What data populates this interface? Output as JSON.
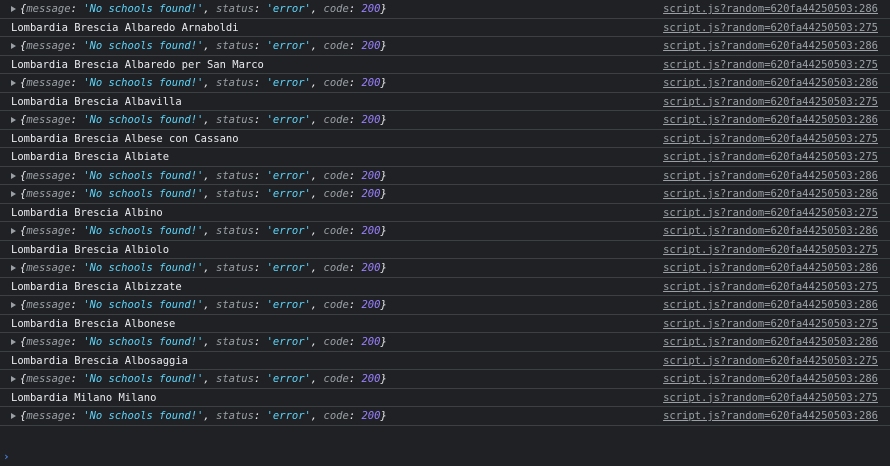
{
  "prompt_symbol": "›",
  "entries": [
    {
      "kind": "obj",
      "source": "script.js?random=620fa44250503:286"
    },
    {
      "kind": "log",
      "text": "Lombardia Brescia Albaredo Arnaboldi",
      "source": "script.js?random=620fa44250503:275"
    },
    {
      "kind": "obj",
      "source": "script.js?random=620fa44250503:286"
    },
    {
      "kind": "log",
      "text": "Lombardia Brescia Albaredo per San Marco",
      "source": "script.js?random=620fa44250503:275"
    },
    {
      "kind": "obj",
      "source": "script.js?random=620fa44250503:286"
    },
    {
      "kind": "log",
      "text": "Lombardia Brescia Albavilla",
      "source": "script.js?random=620fa44250503:275"
    },
    {
      "kind": "obj",
      "source": "script.js?random=620fa44250503:286"
    },
    {
      "kind": "log",
      "text": "Lombardia Brescia Albese con Cassano",
      "source": "script.js?random=620fa44250503:275"
    },
    {
      "kind": "log",
      "text": "Lombardia Brescia Albiate",
      "source": "script.js?random=620fa44250503:275"
    },
    {
      "kind": "obj",
      "source": "script.js?random=620fa44250503:286"
    },
    {
      "kind": "obj",
      "source": "script.js?random=620fa44250503:286"
    },
    {
      "kind": "log",
      "text": "Lombardia Brescia Albino",
      "source": "script.js?random=620fa44250503:275"
    },
    {
      "kind": "obj",
      "source": "script.js?random=620fa44250503:286"
    },
    {
      "kind": "log",
      "text": "Lombardia Brescia Albiolo",
      "source": "script.js?random=620fa44250503:275"
    },
    {
      "kind": "obj",
      "source": "script.js?random=620fa44250503:286"
    },
    {
      "kind": "log",
      "text": "Lombardia Brescia Albizzate",
      "source": "script.js?random=620fa44250503:275"
    },
    {
      "kind": "obj",
      "source": "script.js?random=620fa44250503:286"
    },
    {
      "kind": "log",
      "text": "Lombardia Brescia Albonese",
      "source": "script.js?random=620fa44250503:275"
    },
    {
      "kind": "obj",
      "source": "script.js?random=620fa44250503:286"
    },
    {
      "kind": "log",
      "text": "Lombardia Brescia Albosaggia",
      "source": "script.js?random=620fa44250503:275"
    },
    {
      "kind": "obj",
      "source": "script.js?random=620fa44250503:286"
    },
    {
      "kind": "log",
      "text": "Lombardia Milano Milano",
      "source": "script.js?random=620fa44250503:275"
    },
    {
      "kind": "obj",
      "source": "script.js?random=620fa44250503:286"
    }
  ],
  "object_preview": {
    "open": "{",
    "close": "}",
    "k1": "message",
    "v1": "'No schools found!'",
    "k2": "status",
    "v2": "'error'",
    "k3": "code",
    "v3": "200"
  }
}
